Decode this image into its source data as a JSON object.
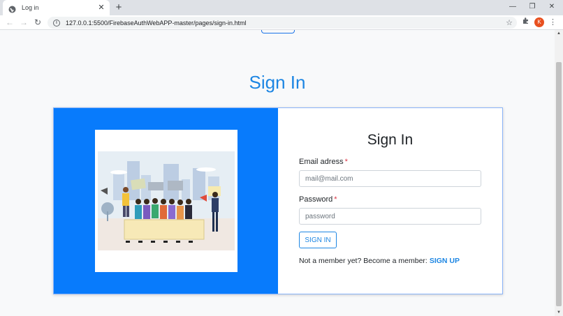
{
  "browser": {
    "tab_title": "Log in",
    "tab_close": "✕",
    "new_tab": "+",
    "url": "127.0.0.1:5500/FirebaseAuthWebAPP-master/pages/sign-in.html",
    "avatar_letter": "K",
    "window_controls": {
      "minimize": "—",
      "restore": "❐",
      "close": "✕"
    },
    "nav": {
      "back": "←",
      "forward": "→",
      "reload": "↻"
    },
    "icons": [
      "globe-icon",
      "info-icon",
      "star-icon",
      "extensions-icon",
      "menu-icon"
    ]
  },
  "page": {
    "title": "Sign In"
  },
  "form": {
    "title": "Sign In",
    "email_label": "Email adress",
    "email_placeholder": "mail@mail.com",
    "password_label": "Password",
    "password_placeholder": "password",
    "required_marker": "*",
    "submit_label": "SIGN IN",
    "member_prompt": "Not a member yet? Become a member:",
    "signup_label": "SIGN UP"
  },
  "colors": {
    "accent": "#1d86e3",
    "panel_blue": "#087bfc",
    "required": "#dc3545"
  }
}
